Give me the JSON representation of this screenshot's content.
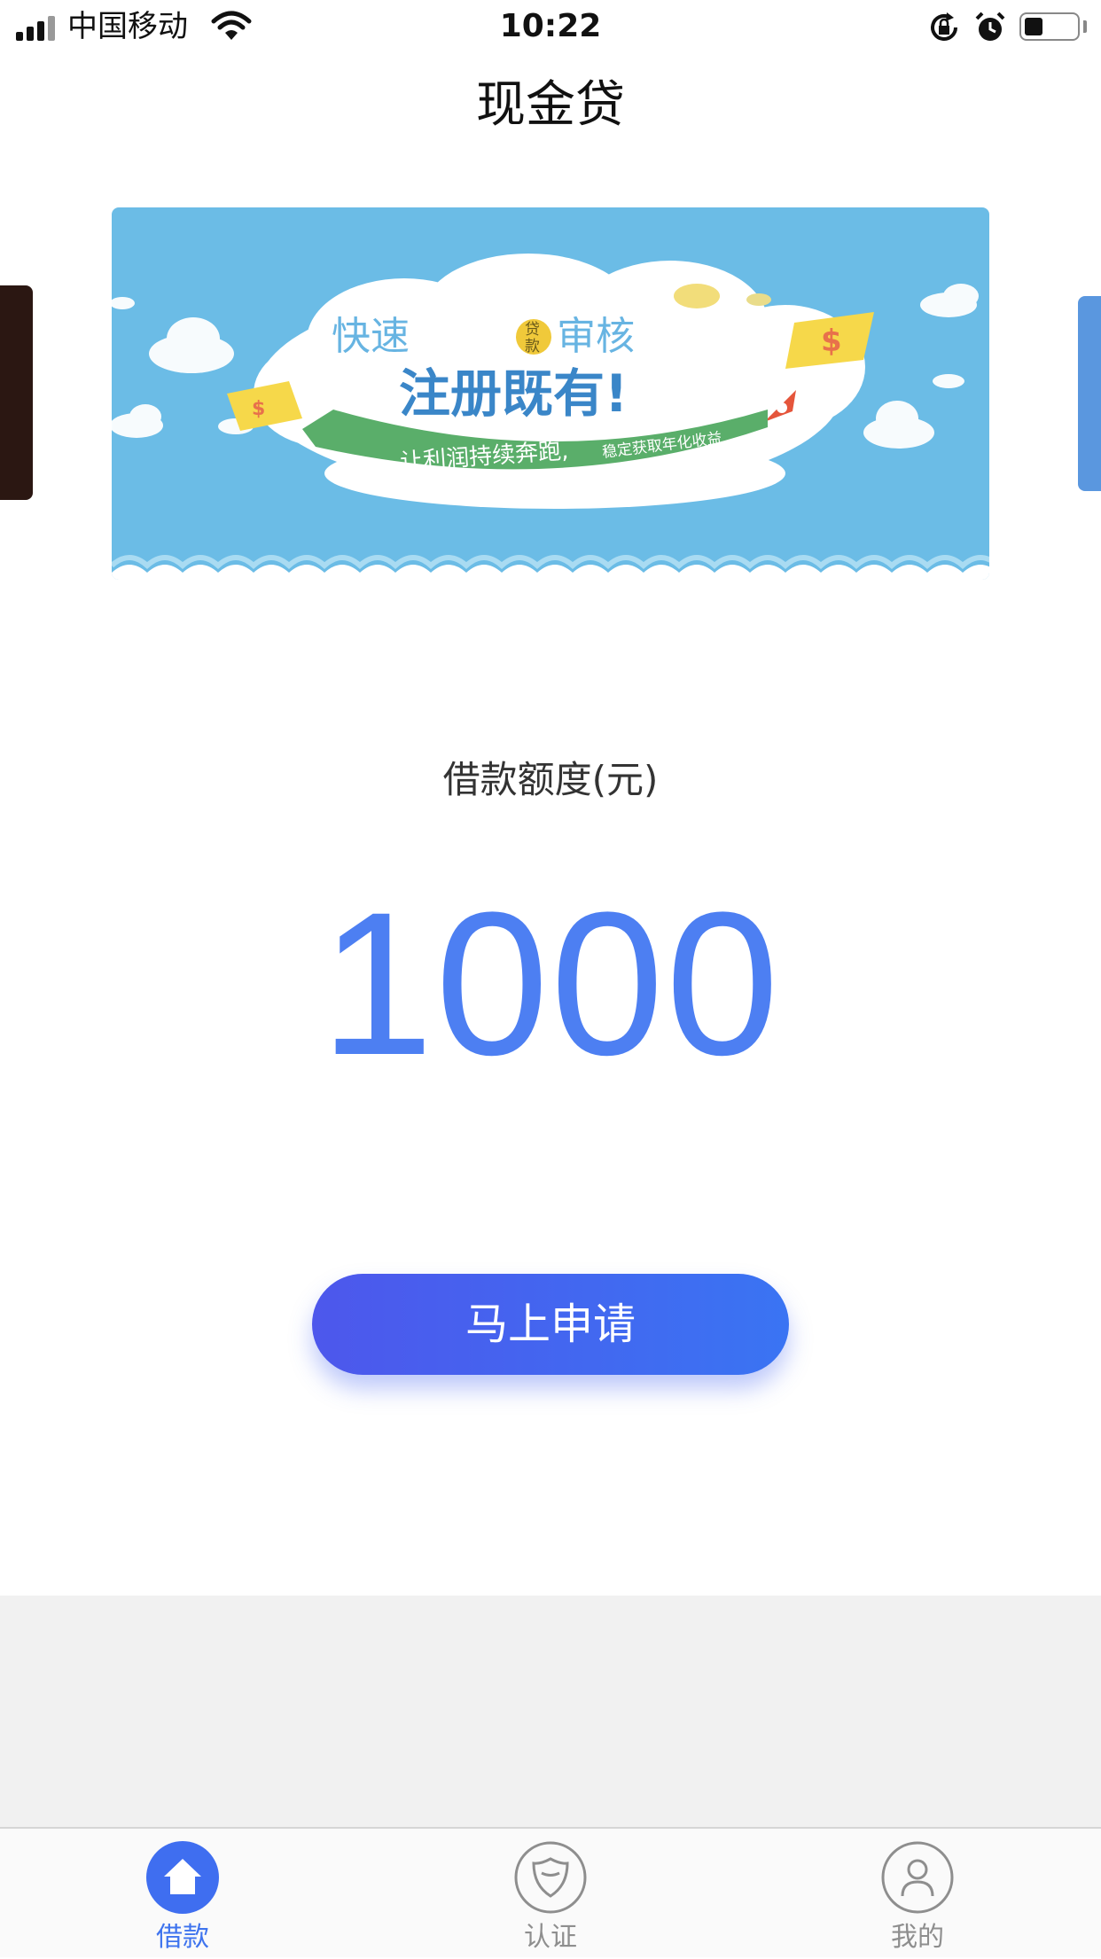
{
  "status_bar": {
    "carrier": "中国移动",
    "time": "10:22",
    "icons": [
      "signal-icon",
      "wifi-icon",
      "rotation-lock-icon",
      "alarm-icon",
      "battery-icon"
    ],
    "battery_level": 0.35
  },
  "header": {
    "title": "现金贷"
  },
  "banner": {
    "headline_left": "快速",
    "badge_top": "贷",
    "badge_bottom": "款",
    "headline_right": "审核",
    "main_slogan": "注册既有!",
    "ribbon_text": "让利润持续奔跑,",
    "ribbon_subtext": "稳定获取年化收益",
    "colors": {
      "sky": "#6bbce6",
      "ribbon": "#5aae6a",
      "slogan": "#3a86c8"
    }
  },
  "loan": {
    "label": "借款额度(元)",
    "amount": "1000"
  },
  "apply_button": {
    "label": "马上申请"
  },
  "tabs": [
    {
      "label": "借款",
      "icon": "home-icon",
      "active": true
    },
    {
      "label": "认证",
      "icon": "shield-icon",
      "active": false
    },
    {
      "label": "我的",
      "icon": "user-icon",
      "active": false
    }
  ],
  "colors": {
    "accent": "#4d7ff2",
    "tab_active": "#3f74ee",
    "tab_inactive": "#8e8e8e"
  }
}
